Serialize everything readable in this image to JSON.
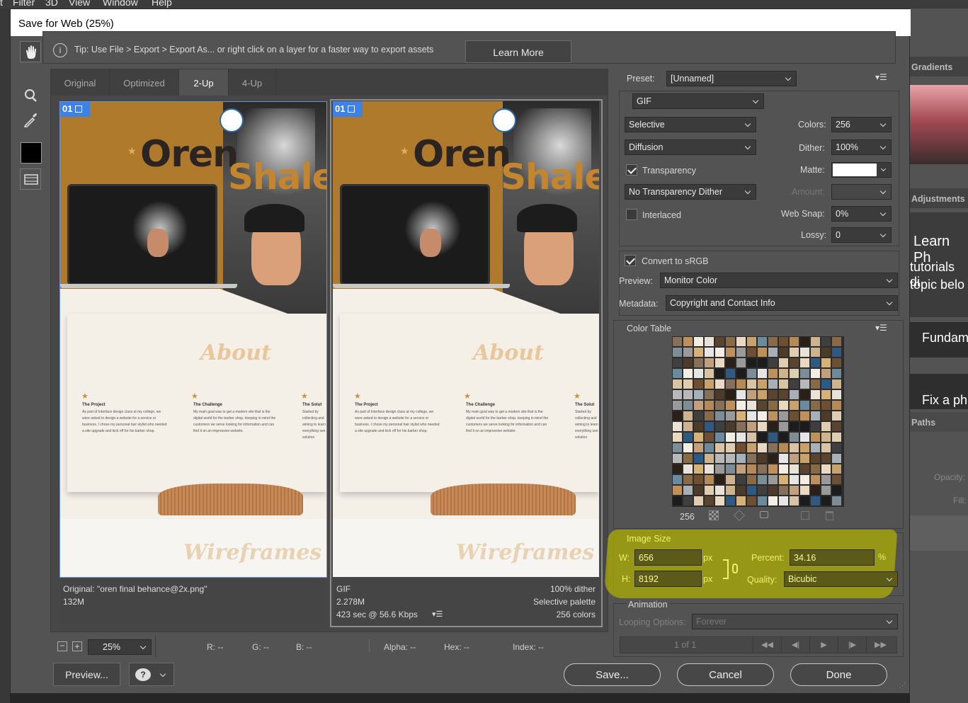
{
  "menubar": {
    "items": [
      "t",
      "Filter",
      "3D",
      "View",
      "Window",
      "Help"
    ]
  },
  "dialog": {
    "title": "Save for Web (25%)",
    "tip": "Tip: Use File > Export > Export As...  or right click on a layer for a faster way to export assets",
    "learn_more": "Learn More",
    "tabs": [
      "Original",
      "Optimized",
      "2-Up",
      "4-Up"
    ],
    "active_tab": "2-Up",
    "pane_badge": "01",
    "artwork": {
      "title_line1": "Oren",
      "title_line2": "Shale",
      "about": "About",
      "wireframes": "Wireframes",
      "col1_title": "The Project",
      "col2_title": "The Challenge",
      "col3_title": "The Solut",
      "col1_body": "As part of Interface design class at my college, we were asked to design a website for a service or business. I chose my personal hair stylist who needed a site upgrade and kick off for his barber shop.",
      "col2_body": "My main goal was to get a modern site that is the digital world for the barber shop, keeping in mind the customers we serve looking for information and can find it on an impressive website.",
      "col3_body": "Started by collecting and aiming to learn everything see solution"
    },
    "original_info": {
      "line1": "Original: \"oren final behance@2x.png\"",
      "line2": "132M"
    },
    "optimized_info": {
      "format": "GIF",
      "size": "2.278M",
      "speed": "423 sec @ 56.6 Kbps",
      "dither": "100% dither",
      "palette": "Selective palette",
      "colors": "256 colors"
    },
    "status": {
      "zoom": "25%",
      "r": "R: --",
      "g": "G: --",
      "b": "B: --",
      "alpha": "Alpha: --",
      "hex": "Hex: --",
      "index": "Index: --"
    },
    "buttons": {
      "preview": "Preview...",
      "save": "Save...",
      "cancel": "Cancel",
      "done": "Done"
    },
    "settings": {
      "preset_label": "Preset:",
      "preset_value": "[Unnamed]",
      "format": "GIF",
      "reduction": "Selective",
      "dither_algo": "Diffusion",
      "transparency": "Transparency",
      "transparency_dither": "No Transparency Dither",
      "interlaced": "Interlaced",
      "colors_label": "Colors:",
      "colors_value": "256",
      "dither_label": "Dither:",
      "dither_value": "100%",
      "matte_label": "Matte:",
      "amount_label": "Amount:",
      "websnap_label": "Web Snap:",
      "websnap_value": "0%",
      "lossy_label": "Lossy:",
      "lossy_value": "0",
      "convert_srgb": "Convert to sRGB",
      "preview_label": "Preview:",
      "preview_value": "Monitor Color",
      "metadata_label": "Metadata:",
      "metadata_value": "Copyright and Contact Info",
      "color_table_label": "Color Table",
      "color_count": "256",
      "image_size_label": "Image Size",
      "w_label": "W:",
      "w_value": "656",
      "h_label": "H:",
      "h_value": "8192",
      "px": "px",
      "percent_label": "Percent:",
      "percent_value": "34.16",
      "percent_unit": "%",
      "quality_label": "Quality:",
      "quality_value": "Bicubic",
      "animation_label": "Animation",
      "looping_label": "Looping Options:",
      "looping_value": "Forever",
      "frame_counter": "1 of 1"
    }
  },
  "photoshop_right": {
    "gradients": "Gradients",
    "adjustments": "Adjustments",
    "learn": "Learn Ph",
    "tutorials1": "tutorials di",
    "tutorials2": "topic belo",
    "fundam": "Fundam",
    "fix": "Fix a ph",
    "paths": "Paths",
    "opacity": "Opacity:",
    "fill": "Fill:"
  },
  "colors": {
    "brand_brown": "#b07a2d",
    "highlight": "#b0b000",
    "badge_blue": "#3d82e6"
  }
}
